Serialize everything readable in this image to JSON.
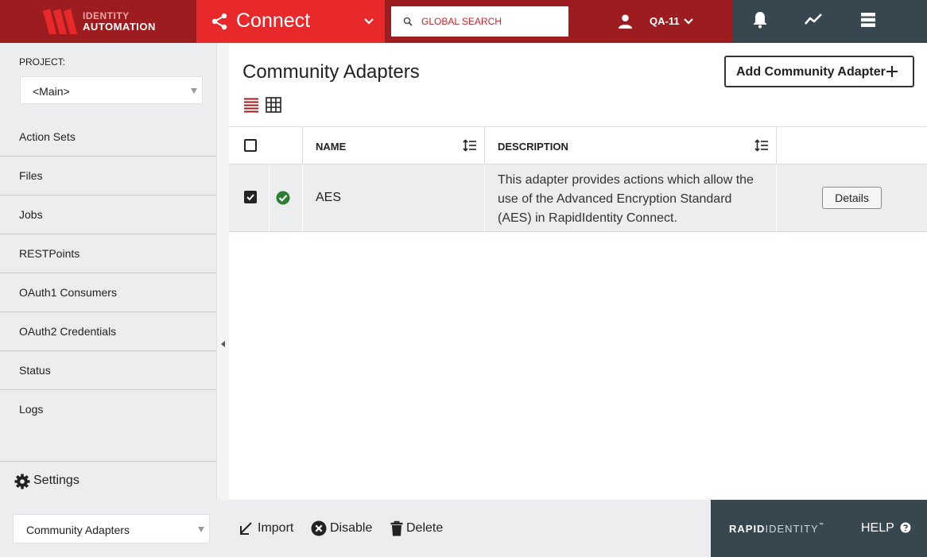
{
  "header": {
    "logo_line1": "IDENTITY",
    "logo_line2": "AUTOMATION",
    "module_name": "Connect",
    "search_placeholder": "GLOBAL SEARCH",
    "user_label": "QA-11",
    "icons": [
      "bell-icon",
      "activity-icon",
      "menu-list-icon"
    ]
  },
  "sidebar": {
    "project_label": "PROJECT:",
    "project_value": "<Main>",
    "items": [
      {
        "label": "Action Sets"
      },
      {
        "label": "Files"
      },
      {
        "label": "Jobs"
      },
      {
        "label": "RESTPoints"
      },
      {
        "label": "OAuth1 Consumers"
      },
      {
        "label": "OAuth2 Credentials"
      },
      {
        "label": "Status"
      },
      {
        "label": "Logs"
      }
    ],
    "settings_label": "Settings"
  },
  "main": {
    "title": "Community Adapters",
    "add_button_label": "Add Community Adapter",
    "table": {
      "columns": [
        "NAME",
        "DESCRIPTION"
      ],
      "rows": [
        {
          "selected": true,
          "status": "enabled",
          "name": "AES",
          "description": "This adapter provides actions which allow the use of the Advanced Encryption Standard (AES) in RapidIdentity Connect.",
          "action_label": "Details"
        }
      ]
    }
  },
  "footer": {
    "view_select_value": "Community Adapters",
    "actions": [
      {
        "label": "Import",
        "icon": "import-arrow-icon"
      },
      {
        "label": "Disable",
        "icon": "disable-icon"
      },
      {
        "label": "Delete",
        "icon": "trash-icon"
      }
    ],
    "brand_bold": "RAPID",
    "brand_light": "IDENTITY",
    "brand_tm": "™",
    "help_label": "HELP"
  },
  "colors": {
    "brand_dark_red": "#9d1c20",
    "brand_red": "#e8292c",
    "slate": "#37474f",
    "panel_gray": "#ebedee",
    "success_green": "#2e7d32"
  }
}
